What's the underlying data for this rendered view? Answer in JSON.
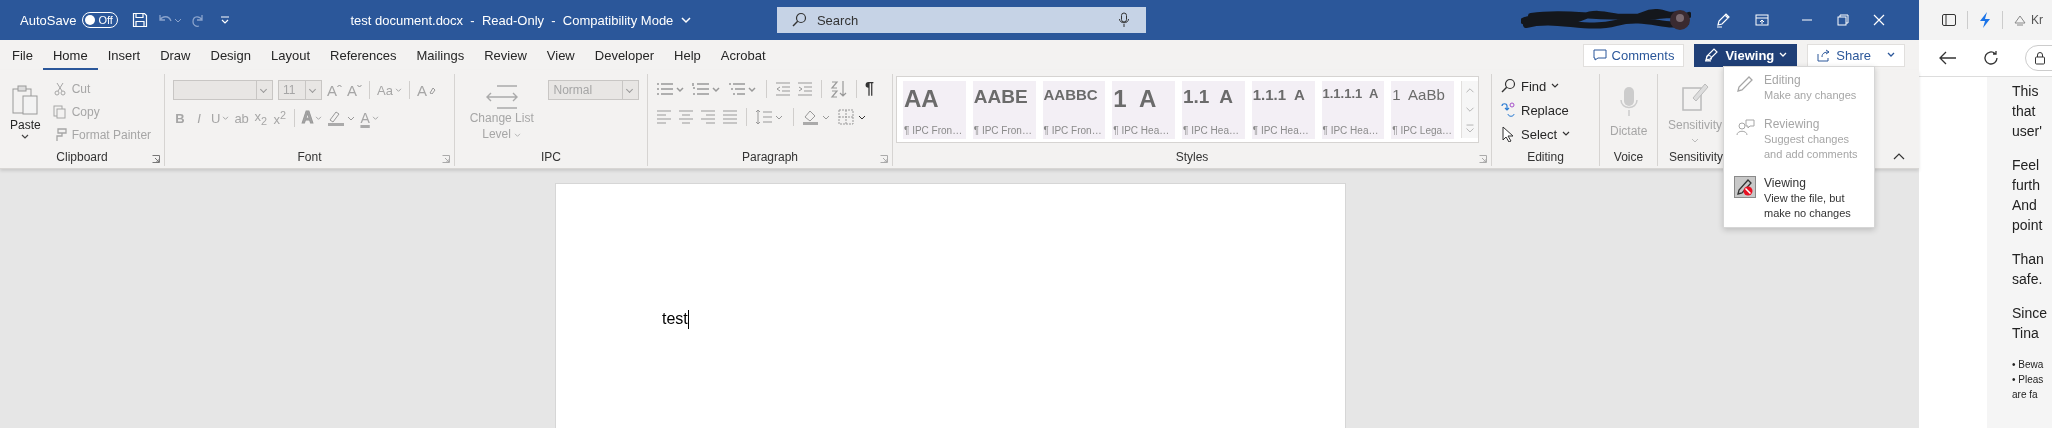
{
  "title_bar": {
    "autosave_label": "AutoSave",
    "autosave": {
      "on": false,
      "label": "Off"
    },
    "document_title": "test document.docx  -  Read-Only  -  Compatibility Mode",
    "search": {
      "placeholder": "Search"
    }
  },
  "tabs": [
    {
      "label": "File",
      "selected": false
    },
    {
      "label": "Home",
      "selected": true
    },
    {
      "label": "Insert",
      "selected": false
    },
    {
      "label": "Draw",
      "selected": false
    },
    {
      "label": "Design",
      "selected": false
    },
    {
      "label": "Layout",
      "selected": false
    },
    {
      "label": "References",
      "selected": false
    },
    {
      "label": "Mailings",
      "selected": false
    },
    {
      "label": "Review",
      "selected": false
    },
    {
      "label": "View",
      "selected": false
    },
    {
      "label": "Developer",
      "selected": false
    },
    {
      "label": "Help",
      "selected": false
    },
    {
      "label": "Acrobat",
      "selected": false
    }
  ],
  "collaboration": {
    "comments": "Comments",
    "mode": "Viewing",
    "share": "Share"
  },
  "ribbon": {
    "clipboard": {
      "label": "Clipboard",
      "paste": "Paste",
      "items": [
        {
          "label": "Cut",
          "kind": "cut",
          "disabled": true
        },
        {
          "label": "Copy",
          "kind": "copy",
          "disabled": true
        },
        {
          "label": "Format Painter",
          "kind": "painter",
          "disabled": true
        }
      ]
    },
    "font": {
      "label": "Font",
      "size": "11",
      "grow": "Aˆ",
      "shrink": "Aˇ",
      "case_button": "Aa",
      "clear": "A",
      "format_buttons": [
        {
          "label": "**B**",
          "dropdown": false
        },
        {
          "label": "*I*",
          "dropdown": false
        },
        {
          "label": "U",
          "dropdown": true
        },
        {
          "label": "ab",
          "dropdown": false
        },
        {
          "label": "x$_{2}$",
          "dropdown": false
        },
        {
          "label": "x$^{2}$",
          "dropdown": false
        }
      ],
      "effects": "A",
      "font_color": "A"
    },
    "ipc": {
      "label": "IPC",
      "change_list_level": "Change List",
      "level": "Level",
      "style_box": "Normal"
    },
    "paragraph": {
      "label": "Paragraph",
      "show_marks": "¶"
    },
    "styles": {
      "label": "Styles",
      "items": [
        {
          "preview": "AA",
          "name": "¶ IPC Fron…",
          "kind": "huge"
        },
        {
          "preview": "AABE",
          "name": "¶ IPC Fron…",
          "kind": "big"
        },
        {
          "preview": "AABBC",
          "name": "¶ IPC Fron…",
          "kind": "medium"
        },
        {
          "preview": "1  A",
          "name": "¶ IPC Hea…",
          "kind": "huge"
        },
        {
          "preview": "1.1  A",
          "name": "¶ IPC Hea…",
          "kind": "big"
        },
        {
          "preview": "1.1.1  A",
          "name": "¶ IPC Hea…",
          "kind": "medium"
        },
        {
          "preview": "1.1.1.1  A",
          "name": "¶ IPC Hea…",
          "kind": "small"
        },
        {
          "preview": "1  AaBb",
          "name": "¶ IPC Lega…",
          "kind": "light"
        }
      ]
    },
    "editing": {
      "label": "Editing",
      "items": [
        {
          "label": "Find",
          "kind": "find"
        },
        {
          "label": "Replace",
          "kind": "replace"
        },
        {
          "label": "Select",
          "kind": "select"
        }
      ]
    },
    "voice": {
      "label": "Voice",
      "dictate": "Dictate"
    },
    "sensitivity": {
      "label": "Sensitivity",
      "button": "Sensitivity"
    }
  },
  "mode_menu": {
    "items": [
      {
        "title": "Editing",
        "description": "Make any changes",
        "kind": "edit",
        "disabled": true,
        "selected": false
      },
      {
        "title": "Reviewing",
        "description": "Suggest changes and add comments",
        "kind": "review",
        "disabled": true,
        "selected": false
      },
      {
        "title": "Viewing",
        "description": "View the file, but make no changes",
        "kind": "view",
        "disabled": false,
        "selected": true
      }
    ]
  },
  "document": {
    "text": "test"
  },
  "side_pane": {
    "tab_label": "Kr",
    "paragraphs": [
      {
        "kind": "body",
        "lines": [
          "This",
          "that",
          "user'"
        ]
      },
      {
        "kind": "body",
        "lines": [
          "Feel",
          "furth",
          "And",
          "point"
        ]
      },
      {
        "kind": "body",
        "lines": [
          "Than",
          "safe."
        ]
      },
      {
        "kind": "body",
        "lines": [
          "Since",
          "Tina"
        ]
      },
      {
        "kind": "footnote",
        "lines": [
          "• Bewa",
          "• Pleas",
          "are fa"
        ]
      }
    ]
  }
}
